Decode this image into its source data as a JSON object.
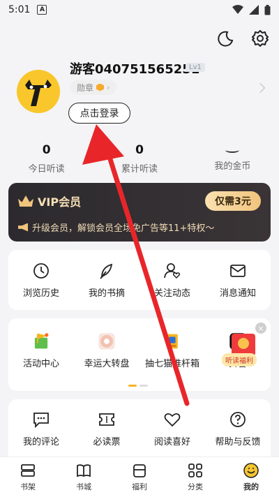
{
  "status_bar": {
    "time": "5:01",
    "badge": "A"
  },
  "top_icons": [
    "moon-icon",
    "gear-icon"
  ],
  "profile": {
    "username": "游客040751565251",
    "level": "Lv1",
    "badge_label": "勋章",
    "login_button": "点击登录"
  },
  "stats": [
    {
      "value": "0",
      "label": "今日听读"
    },
    {
      "value": "0",
      "label": "累计听读"
    },
    {
      "value": "",
      "label": "我的金币"
    }
  ],
  "vip": {
    "title": "VIP会员",
    "button": "仅需3元",
    "description": "升级会员，解锁会员全场免广告等11+特权～"
  },
  "shortcuts": [
    {
      "label": "浏览历史",
      "icon": "clock-icon"
    },
    {
      "label": "我的书摘",
      "icon": "feather-icon"
    },
    {
      "label": "关注动态",
      "icon": "user-heart-icon"
    },
    {
      "label": "消息通知",
      "icon": "mail-icon"
    }
  ],
  "activities": [
    {
      "label": "活动中心",
      "icon": "activity-flag-icon"
    },
    {
      "label": "幸运大转盘",
      "icon": "wheel-icon"
    },
    {
      "label": "抽七猫推杆箱",
      "icon": "prize-box-icon"
    },
    {
      "label": "抖音",
      "icon": "tiktok-icon"
    }
  ],
  "red_packet": {
    "label": "听读福利"
  },
  "more": [
    {
      "label": "我的评论",
      "icon": "comment-icon"
    },
    {
      "label": "必读票",
      "icon": "ticket-icon"
    },
    {
      "label": "阅读喜好",
      "icon": "heart-icon"
    },
    {
      "label": "帮助与反馈",
      "icon": "help-icon"
    }
  ],
  "tabs": [
    {
      "label": "书架",
      "icon": "bookshelf-icon"
    },
    {
      "label": "书城",
      "icon": "book-icon"
    },
    {
      "label": "福利",
      "icon": "gift-icon"
    },
    {
      "label": "分类",
      "icon": "grid-icon"
    },
    {
      "label": "我的",
      "icon": "smiley-icon",
      "active": true
    }
  ],
  "colors": {
    "accent": "#f5b521",
    "arrow": "#e8262a",
    "vip_gold": "#f1c47d"
  }
}
